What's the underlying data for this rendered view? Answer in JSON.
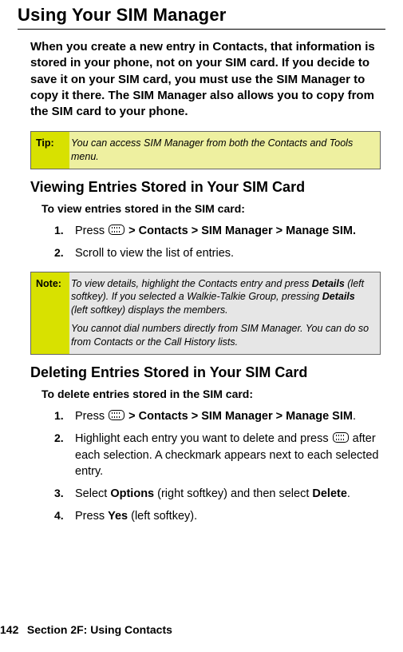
{
  "heading": "Using Your SIM Manager",
  "intro": "When you create a new entry in Contacts, that information is stored in your phone, not on your SIM card. If you decide to save it on your SIM card, you must use the SIM Manager to copy it there. The SIM Manager also allows you to copy from the SIM card to your phone.",
  "tip": {
    "label": "Tip:",
    "text": "You can access SIM Manager from both the Contacts and Tools menu."
  },
  "view": {
    "heading": "Viewing Entries Stored in Your SIM Card",
    "lead": "To view entries stored in the SIM card:",
    "steps": [
      {
        "num": "1.",
        "prefix": "Press ",
        "gt1": " > ",
        "b1": "Contacts",
        "gt2": " > ",
        "b2": "SIM Manager",
        "gt3": " > ",
        "b3": "Manage SIM.",
        "suffix": ""
      },
      {
        "num": "2.",
        "text": "Scroll to view the list of entries."
      }
    ]
  },
  "note": {
    "label": "Note:",
    "p1a": "To view details, highlight the Contacts entry and press ",
    "p1b": "Details",
    "p1c": " (left softkey). If you selected a Walkie-Talkie Group, pressing ",
    "p1d": "Details",
    "p1e": " (left softkey) displays the members.",
    "p2": "You cannot dial numbers directly from SIM Manager. You can do so from Contacts or the Call History lists."
  },
  "delete": {
    "heading": "Deleting Entries Stored in Your SIM Card",
    "lead": "To delete entries stored in the SIM card:",
    "steps": [
      {
        "num": "1.",
        "prefix": "Press ",
        "gt1": " > ",
        "b1": "Contacts",
        "gt2": " > ",
        "b2": "SIM Manager",
        "gt3": " > ",
        "b3": "Manage SIM",
        "suffix": "."
      },
      {
        "num": "2.",
        "t1": "Highlight each entry you want to delete and press ",
        "t2": " after each selection. A checkmark appears next to each selected entry."
      },
      {
        "num": "3.",
        "t1": "Select ",
        "b1": "Options",
        "t2": " (right softkey) and then select ",
        "b2": "Delete",
        "t3": "."
      },
      {
        "num": "4.",
        "t1": "Press ",
        "b1": "Yes",
        "t2": " (left softkey)."
      }
    ]
  },
  "footer": {
    "page": "142",
    "section": "Section 2F: Using Contacts"
  }
}
